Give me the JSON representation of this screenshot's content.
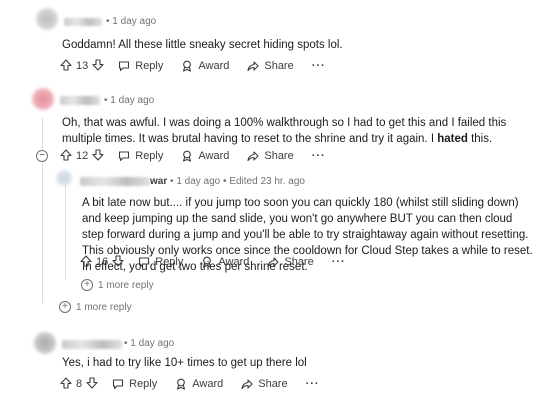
{
  "comments": [
    {
      "time": "1 day ago",
      "text": "Goddamn! All these little sneaky secret hiding spots lol.",
      "votes": "13",
      "reply": "Reply",
      "award": "Award",
      "share": "Share",
      "more": "···"
    },
    {
      "time": "1 day ago",
      "text_before": "Oh, that was awful. I was doing a 100% walkthrough so I had to get this and I failed this multiple times. It was brutal having to reset to the shrine and try it again. I ",
      "text_bold": "hated",
      "text_after": " this.",
      "votes": "12",
      "reply": "Reply",
      "award": "Award",
      "share": "Share",
      "more": "···"
    },
    {
      "user_fragment": "war",
      "time": "1 day ago",
      "edited": "Edited 23 hr. ago",
      "text": "A bit late now but.... if you jump too soon you can quickly 180 (whilst still sliding down) and keep jumping up the sand slide, you won't go anywhere BUT you can then cloud step forward during a jump and you'll be able to try straightaway again without resetting. This obviously only works once since the cooldown for Cloud Step takes a while to reset. In effect, you'd get two tries per shrine reset.",
      "votes": "16",
      "reply": "Reply",
      "award": "Award",
      "share": "Share",
      "more": "···",
      "more_reply": "1 more reply"
    },
    {
      "time": "1 day ago",
      "text": "Yes, i had to try like 10+ times to get up there lol",
      "votes": "8",
      "reply": "Reply",
      "award": "Award",
      "share": "Share",
      "more": "···"
    }
  ],
  "thread_more_reply": "1 more reply",
  "separator": "•"
}
